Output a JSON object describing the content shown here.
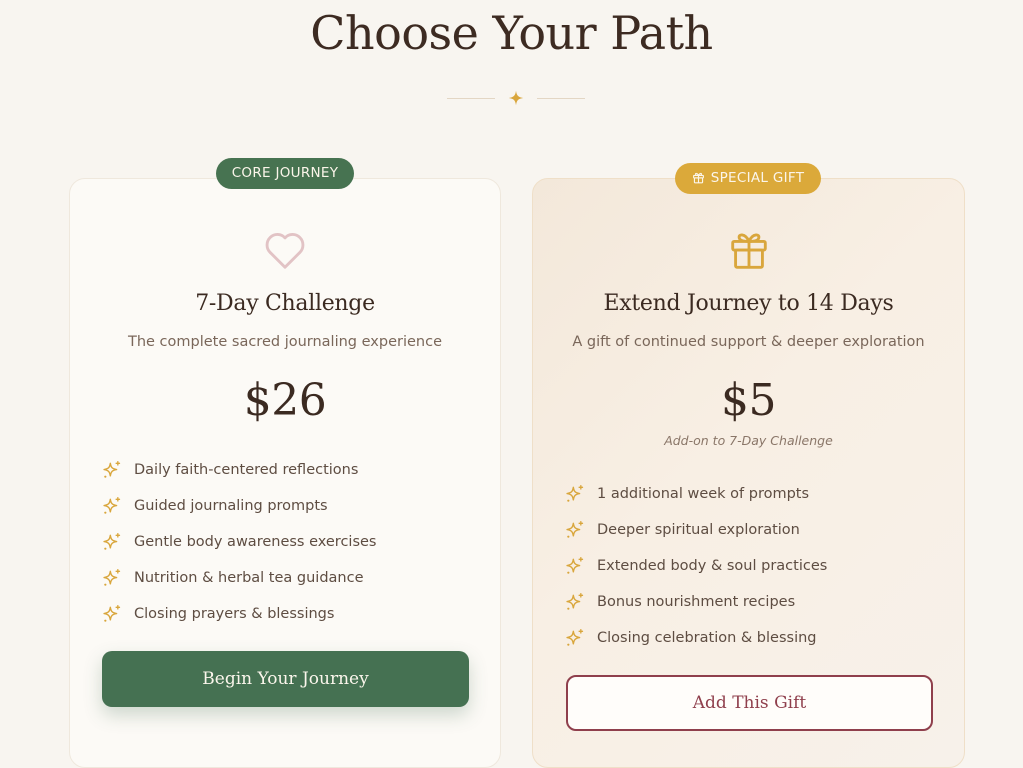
{
  "header": {
    "title": "Choose Your Path",
    "divider_icon": "sparkle-icon"
  },
  "cards": [
    {
      "badge": "CORE JOURNEY",
      "icon": "heart-icon",
      "title": "7-Day Challenge",
      "subtitle": "The complete sacred journaling experience",
      "price": "$26",
      "features": [
        "Daily faith-centered reflections",
        "Guided journaling prompts",
        "Gentle body awareness exercises",
        "Nutrition & herbal tea guidance",
        "Closing prayers & blessings"
      ],
      "button_label": "Begin Your Journey"
    },
    {
      "badge": "SPECIAL GIFT",
      "badge_icon": "gift-icon",
      "icon": "gift-icon",
      "title": "Extend Journey to 14 Days",
      "subtitle": "A gift of continued support & deeper exploration",
      "price": "$5",
      "price_note": "Add-on to 7-Day Challenge",
      "features": [
        "1 additional week of prompts",
        "Deeper spiritual exploration",
        "Extended body & soul practices",
        "Bonus nourishment recipes",
        "Closing celebration & blessing"
      ],
      "button_label": "Add This Gift"
    }
  ],
  "colors": {
    "background": "#f8f5f0",
    "green": "#457152",
    "gold": "#dba93a",
    "burgundy": "#8f3f4c",
    "heart": "#e2c3c5",
    "text_dark": "#3b2a21"
  }
}
